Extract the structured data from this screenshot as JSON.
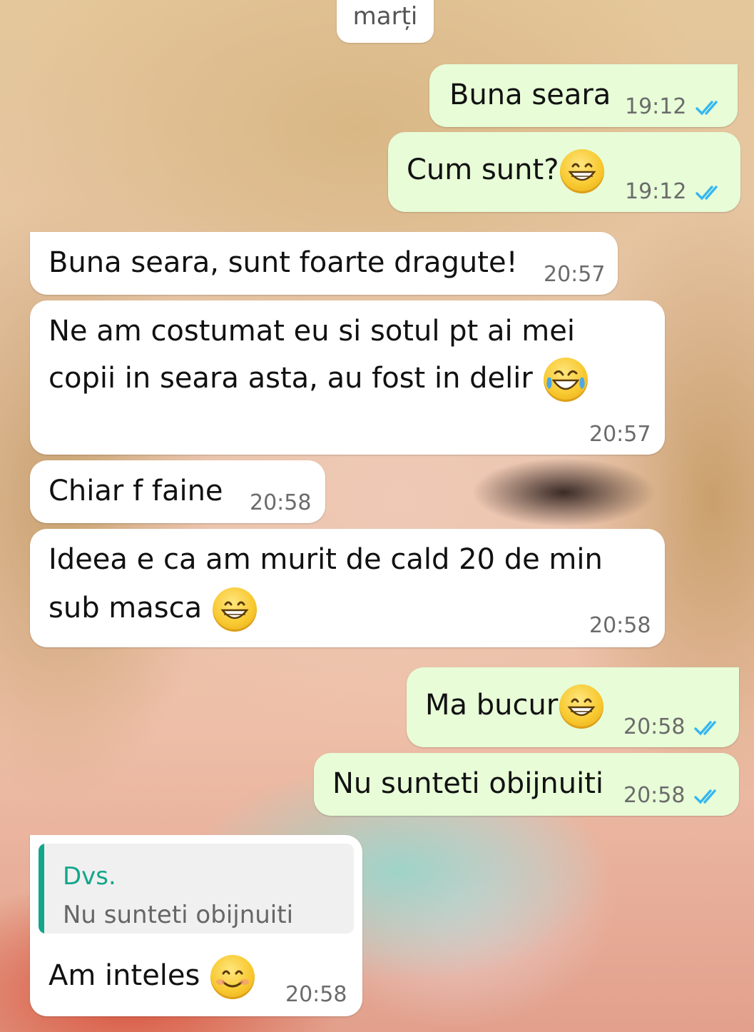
{
  "chat": {
    "date_label": "marți",
    "messages": [
      {
        "direction": "outgoing",
        "text": "Buna seara",
        "time": "19:12",
        "status": "read"
      },
      {
        "direction": "outgoing",
        "text": "Cum sunt?",
        "emoji": "grinning-face-icon",
        "time": "19:12",
        "status": "read"
      },
      {
        "direction": "incoming",
        "text": "Buna seara, sunt foarte dragute!",
        "time": "20:57"
      },
      {
        "direction": "incoming",
        "line1": "Ne am costumat eu si sotul pt ai mei",
        "line2": "copii in seara asta, au fost in delir",
        "emoji": "tears-of-joy-icon",
        "time": "20:57"
      },
      {
        "direction": "incoming",
        "text": "Chiar f faine",
        "time": "20:58"
      },
      {
        "direction": "incoming",
        "line1": "Ideea e ca am murit de cald 20 de min",
        "line2": "sub masca",
        "emoji": "grinning-face-icon",
        "time": "20:58"
      },
      {
        "direction": "outgoing",
        "text": "Ma bucur",
        "emoji": "grinning-face-icon",
        "time": "20:58",
        "status": "read"
      },
      {
        "direction": "outgoing",
        "text": "Nu sunteti obijnuiti",
        "time": "20:58",
        "status": "read"
      },
      {
        "direction": "incoming",
        "reply_to": {
          "author": "Dvs.",
          "text": "Nu sunteti obijnuiti"
        },
        "text": "Am inteles",
        "emoji": "smiling-face-icon",
        "time": "20:58"
      }
    ]
  },
  "colors": {
    "incoming_bubble": "#ffffff",
    "outgoing_bubble": "#e7fcd7",
    "read_ticks": "#34b7f1",
    "quote_accent": "#13a68a"
  }
}
